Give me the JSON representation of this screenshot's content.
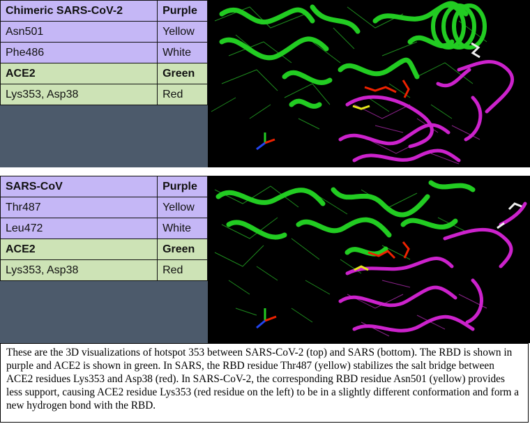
{
  "top_panel": {
    "legend": [
      {
        "label": "Chimeric SARS-CoV-2",
        "color": "Purple",
        "style": "purple-bold"
      },
      {
        "label": "Asn501",
        "color": "Yellow",
        "style": "purple"
      },
      {
        "label": "Phe486",
        "color": "White",
        "style": "purple"
      },
      {
        "label": "ACE2",
        "color": "Green",
        "style": "green-bold"
      },
      {
        "label": "Lys353, Asp38",
        "color": "Red",
        "style": "green"
      }
    ]
  },
  "bottom_panel": {
    "legend": [
      {
        "label": "SARS-CoV",
        "color": "Purple",
        "style": "purple-bold"
      },
      {
        "label": "Thr487",
        "color": "Yellow",
        "style": "purple"
      },
      {
        "label": "Leu472",
        "color": "White",
        "style": "purple"
      },
      {
        "label": "ACE2",
        "color": "Green",
        "style": "green-bold"
      },
      {
        "label": "Lys353, Asp38",
        "color": "Red",
        "style": "green"
      }
    ]
  },
  "caption": "These are the 3D visualizations of hotspot 353 between SARS-CoV-2 (top) and SARS (bottom). The RBD is shown in purple and ACE2 is shown in green. In SARS, the RBD residue Thr487 (yellow) stabilizes the salt bridge between ACE2 residues Lys353 and Asp38 (red). In SARS-CoV-2, the corresponding RBD residue Asn501 (yellow) provides less support, causing ACE2 residue Lys353 (red residue on the left) to be in a slightly different conformation and form a new hydrogen bond with the RBD.",
  "colors": {
    "rbd": "#cc22cc",
    "ace2": "#22cc22",
    "yellow_residue": "#e6e61a",
    "white_residue": "#f0f0f0",
    "red_residue": "#ee2200",
    "legend_purple": "#c5b7f6",
    "legend_green": "#cde3b6",
    "legend_background": "#4c5a6b"
  }
}
